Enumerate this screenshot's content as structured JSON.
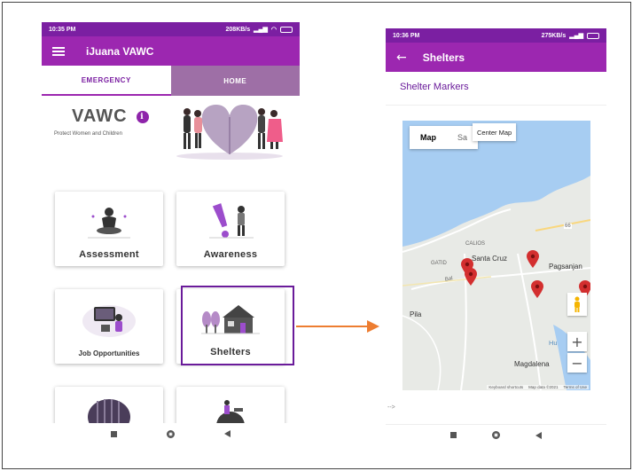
{
  "phone1": {
    "status": {
      "time": "10:35 PM",
      "right": "208KB/s"
    },
    "app_title": "iJuana VAWC",
    "tabs": [
      {
        "label": "EMERGENCY"
      },
      {
        "label": "HOME"
      }
    ],
    "hero": {
      "title": "VAWC",
      "info_glyph": "i",
      "subtitle": "Protect Women and Children"
    },
    "cards": [
      {
        "label": "Assessment",
        "icon": "meditating-person-illustration"
      },
      {
        "label": "Awareness",
        "icon": "exclamation-person-illustration"
      },
      {
        "label": "Job Opportunities",
        "icon": "job-workspace-illustration"
      },
      {
        "label": "Shelters",
        "icon": "house-trees-illustration"
      }
    ]
  },
  "phone2": {
    "status": {
      "time": "10:36 PM",
      "right": "275KB/s"
    },
    "app_title": "Shelters",
    "page_title": "Shelter Markers",
    "map": {
      "type_map": "Map",
      "type_satellite": "Sa",
      "center_button": "Center Map",
      "labels": {
        "santa_cruz": "Santa Cruz",
        "pagsanjan": "Pagsanjan",
        "pila": "Pila",
        "magdalena": "Magdalena",
        "calios": "CALIOS",
        "gatid": "GATID",
        "hui": "Hu",
        "road": "Bal"
      },
      "zoom_in": "+",
      "zoom_out": "−",
      "attribution": [
        "Keyboard shortcuts",
        "Map data ©2021",
        "Terms of Use"
      ]
    },
    "debug": "-->"
  },
  "colors": {
    "primary": "#9c27b0",
    "primary_dark": "#7b1fa2",
    "tab_inactive": "#9e6fa6",
    "arrow": "#ed7d31",
    "marker": "#d32f2f"
  }
}
